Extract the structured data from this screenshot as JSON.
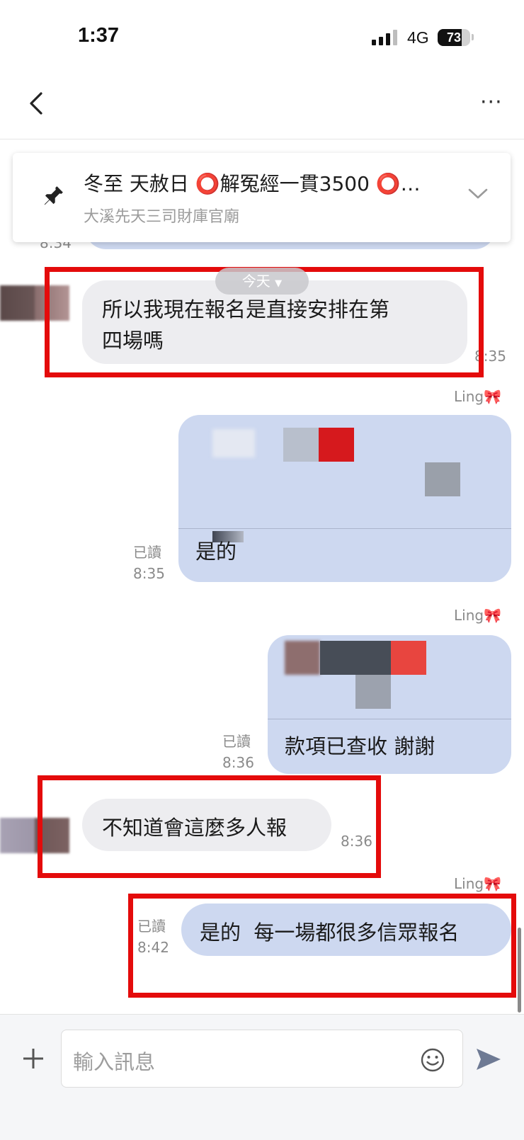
{
  "status_bar": {
    "time": "1:37",
    "network": "4G",
    "battery": "73",
    "battery_level": 0.73
  },
  "header": {
    "back_icon": "chevron-left-icon",
    "more_icon": "more-horizontal-icon",
    "more_glyph": "···"
  },
  "pinned": {
    "icon": "pin-icon",
    "title": "冬至 天赦日 ⭕解冤經一貫3500 ⭕…",
    "subtitle": "大溪先天三司財庫官廟",
    "expand_icon": "chevron-down-icon"
  },
  "prev_message": {
    "time": "8:34"
  },
  "date_pill": {
    "label": "今天"
  },
  "messages": [
    {
      "direction": "in",
      "text": "所以我現在報名是直接安排在第四場嗎",
      "line1": "所以我現在報名是直接安排在第",
      "line2": "四場嗎",
      "time": "8:35"
    },
    {
      "direction": "out",
      "sender": "Ling🎀",
      "reply_preview": "",
      "text": "是的",
      "status": "已讀",
      "time": "8:35"
    },
    {
      "direction": "out",
      "sender": "Ling🎀",
      "reply_preview": "",
      "text": "款項已查收 謝謝",
      "status": "已讀",
      "time": "8:36"
    },
    {
      "direction": "in",
      "text": "不知道會這麼多人報",
      "time": "8:36"
    },
    {
      "direction": "out",
      "sender": "Ling🎀",
      "text": "是的  每一場都很多信眾報名",
      "status": "已讀",
      "time": "8:42"
    }
  ],
  "input": {
    "placeholder": "輸入訊息",
    "add_icon": "plus-icon",
    "emoji_icon": "smiley-icon",
    "send_icon": "send-icon"
  },
  "colors": {
    "highlight": "#e40b0b",
    "bubble_in": "#ededf0",
    "bubble_out": "#cdd8f0"
  }
}
